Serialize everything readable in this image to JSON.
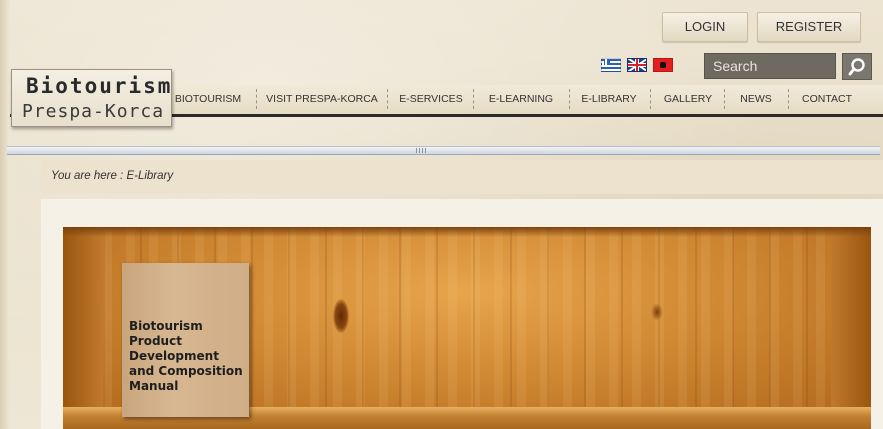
{
  "auth": {
    "login": "LOGIN",
    "register": "REGISTER"
  },
  "languages": [
    {
      "name": "greek-flag-icon"
    },
    {
      "name": "uk-flag-icon"
    },
    {
      "name": "albanian-flag-icon"
    }
  ],
  "search": {
    "placeholder": "Search",
    "icon": "search-icon"
  },
  "logo": {
    "title": "Biotourism",
    "subtitle": "Prespa-Korca"
  },
  "nav": {
    "items": [
      "BIOTOURISM",
      "VISIT PRESPA-KORCA",
      "E-SERVICES",
      "E-LEARNING",
      "E-LIBRARY",
      "GALLERY",
      "NEWS",
      "CONTACT"
    ]
  },
  "breadcrumb": "You are here : E-Library",
  "book": {
    "title": "Biotourism Product Development and Composition Manual"
  },
  "colors": {
    "nav_bottom": "#2b2a28",
    "search_bg": "#6e6a62",
    "shelf": "#b26a1f",
    "book": "#d7b791"
  }
}
